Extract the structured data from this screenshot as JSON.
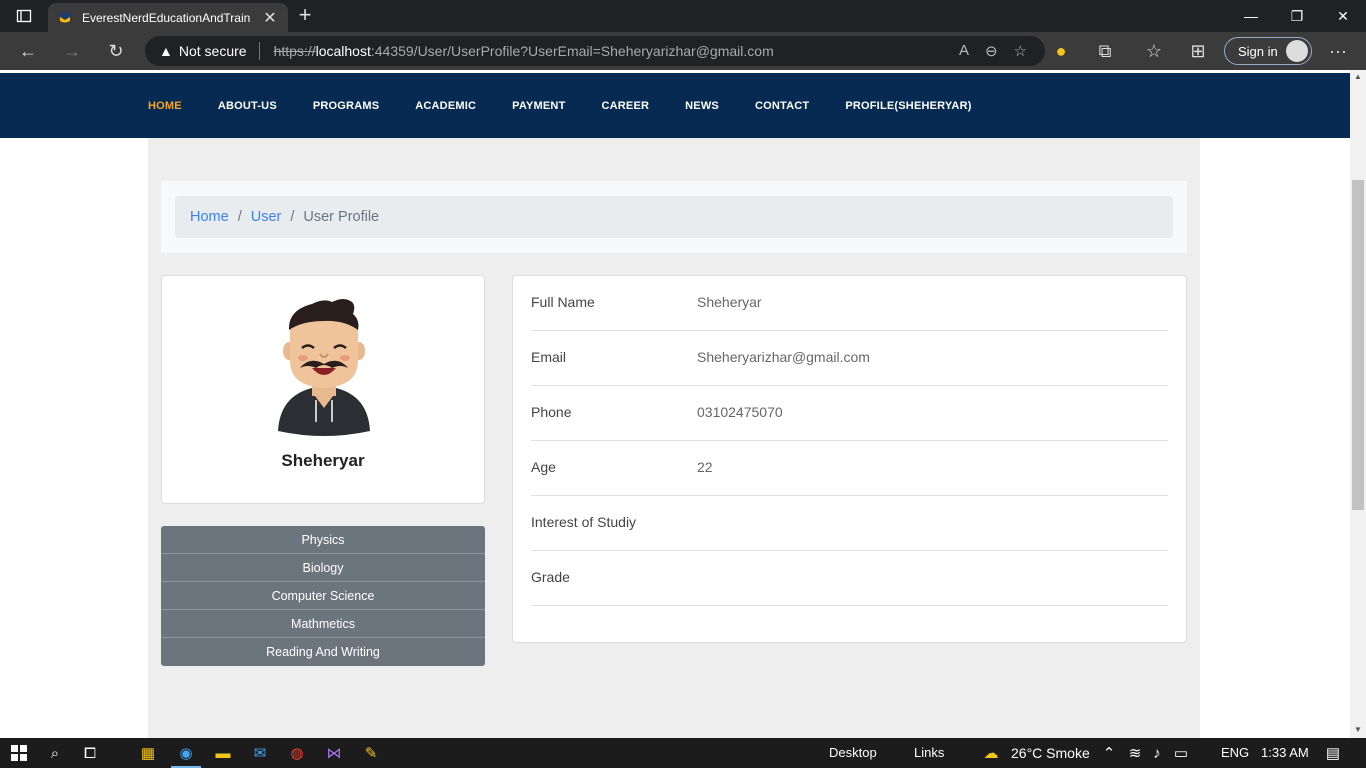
{
  "browser": {
    "tab_title": "EverestNerdEducationAndTrain",
    "security_label": "Not secure",
    "url_scheme": "https://",
    "url_host": "localhost",
    "url_rest": ":44359/User/UserProfile?UserEmail=Sheheryarizhar@gmail.com",
    "signin_label": "Sign in"
  },
  "nav": {
    "items": [
      "HOME",
      "ABOUT-US",
      "PROGRAMS",
      "ACADEMIC",
      "PAYMENT",
      "CAREER",
      "NEWS",
      "CONTACT",
      "PROFILE(SHEHERYAR)"
    ],
    "active_color": "#f5a623",
    "bg_color": "#062a52"
  },
  "breadcrumb": {
    "home": "Home",
    "user": "User",
    "current": "User Profile",
    "divider": "/"
  },
  "profile": {
    "name": "Sheheryar"
  },
  "subjects": [
    "Physics",
    "Biology",
    "Computer Science",
    "Mathmetics",
    "Reading And Writing"
  ],
  "details": [
    {
      "label": "Full Name",
      "value": "Sheheryar"
    },
    {
      "label": "Email",
      "value": "Sheheryarizhar@gmail.com"
    },
    {
      "label": "Phone",
      "value": "03102475070"
    },
    {
      "label": "Age",
      "value": "22"
    },
    {
      "label": "Interest of Studiy",
      "value": ""
    },
    {
      "label": "Grade",
      "value": ""
    }
  ],
  "taskbar": {
    "desktop": "Desktop",
    "links": "Links",
    "weather": "26°C  Smoke",
    "language": "ENG",
    "time": "1:33 AM"
  }
}
